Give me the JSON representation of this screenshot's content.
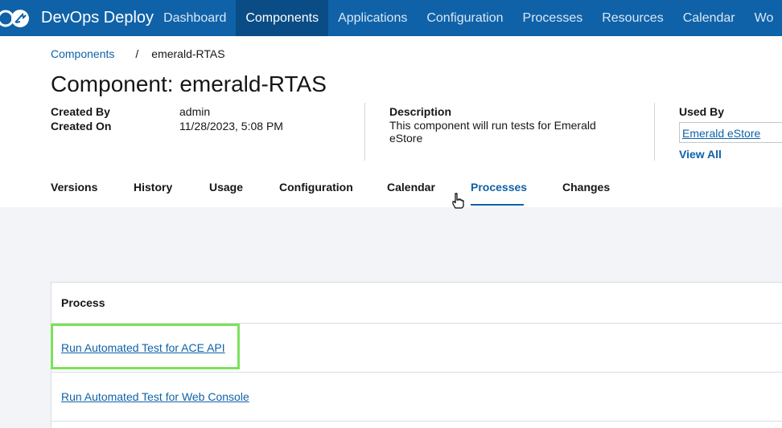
{
  "app": {
    "name": "DevOps Deploy"
  },
  "nav": {
    "items": [
      {
        "label": "Dashboard",
        "active": false
      },
      {
        "label": "Components",
        "active": true
      },
      {
        "label": "Applications",
        "active": false
      },
      {
        "label": "Configuration",
        "active": false
      },
      {
        "label": "Processes",
        "active": false
      },
      {
        "label": "Resources",
        "active": false
      },
      {
        "label": "Calendar",
        "active": false
      },
      {
        "label": "Wo",
        "active": false
      }
    ]
  },
  "breadcrumb": {
    "parent": "Components",
    "separator": "/",
    "current": "emerald-RTAS"
  },
  "page": {
    "title": "Component: emerald-RTAS"
  },
  "meta": {
    "created_by_label": "Created By",
    "created_by_value": "admin",
    "created_on_label": "Created On",
    "created_on_value": "11/28/2023, 5:08 PM",
    "description_label": "Description",
    "description_value": "This component will run tests for Emerald eStore",
    "used_by_label": "Used By",
    "used_by_value": "Emerald eStore",
    "view_all": "View All"
  },
  "tabs": [
    {
      "label": "Versions"
    },
    {
      "label": "History"
    },
    {
      "label": "Usage"
    },
    {
      "label": "Configuration"
    },
    {
      "label": "Calendar"
    },
    {
      "label": "Processes"
    },
    {
      "label": "Changes"
    }
  ],
  "active_tab": "Processes",
  "table": {
    "header": "Process",
    "rows": [
      {
        "name": "Run Automated Test for ACE API"
      },
      {
        "name": "Run Automated Test for Web Console"
      }
    ]
  },
  "colors": {
    "brand": "#0f62a8",
    "nav_active": "#0a4c85",
    "highlight": "#7be25a",
    "page_bg": "#f2f4f8"
  }
}
